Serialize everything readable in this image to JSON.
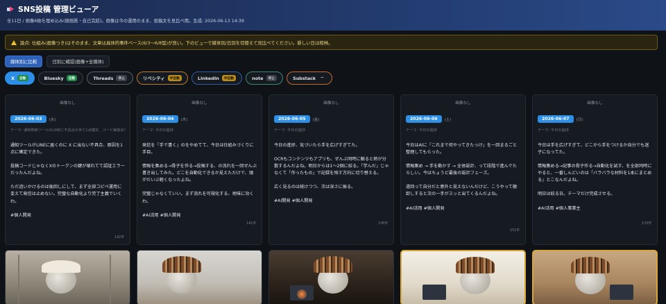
{
  "header": {
    "title": "SNS投稿 管理ビューア",
    "subtitle": "全11日 / 画像6枚を埋め込み(原画質・自己完結)。画像は今の運用のまま、投稿文を見比べ用。生成: 2026-06-13 14:39"
  },
  "notice": {
    "text": "論点: 仕組み(画像つき)はそのまま、文章は具体的事件ベース(6/3〜6/8型)が良い。下のビューで媒体別/日別を切替えて見比べてください。新しい日は榜林。"
  },
  "view_tabs": [
    {
      "label": "媒体別に比較",
      "active": true
    },
    {
      "label": "日別に確認(画像+全媒体)",
      "active": false
    }
  ],
  "platforms": [
    {
      "name": "X",
      "badge": "自動",
      "badge_style": "green",
      "cls": "active"
    },
    {
      "name": "Bluesky",
      "badge": "自動",
      "badge_style": "green",
      "cls": ""
    },
    {
      "name": "Threads",
      "badge": "停止",
      "badge_style": "gray",
      "cls": "threads"
    },
    {
      "name": "リベシティ",
      "badge": "半自動",
      "badge_style": "amber",
      "cls": "rev"
    },
    {
      "name": "LinkedIn",
      "badge": "半自動",
      "badge_style": "amber",
      "cls": "linkedin"
    },
    {
      "name": "note",
      "badge": "停止",
      "badge_style": "gray",
      "cls": "note"
    },
    {
      "name": "Substack",
      "badge": "—",
      "badge_style": "none",
      "cls": "substack"
    }
  ],
  "cards": [
    {
      "no_image": "画像なし",
      "date": "2026-06-03",
      "dow": "(水)",
      "theme": "テーマ: 通知検索ツールのLINEに不具合があり1点確定、コード実装出てた前が受けてた",
      "paragraphs": [
        "通知ツールがLINEに届くのに X に出ない不具合、原因を1点に確定できた。",
        "投稿コードじゃなくXのトークンの鍵が壊れてて認証エラーだったんだよね。",
        "ただ追いかけるのは後回しにして、まず全部コピペ運用に変えて発信は止めない。完璧な自動化より完了主義でいくわ。",
        "#個人開発"
      ],
      "count": "142字",
      "count_top": 339
    },
    {
      "no_image": "画像なし",
      "date": "2026-06-04",
      "dow": "(木)",
      "theme": "テーマ: 今日の進捗",
      "paragraphs": [
        "発信を「手で書く」のをやめてて、今日は仕組みづくりに手目。",
        "情報を集める→骨子を作る→投稿する、の流れを一回ぜんぶ書き出してみた。どこを自動化できるか見えただけで、頭がだいぶ軽くなったよね。",
        "完璧じゃなくていい。まず流れを可視化する、地味に効くわ。",
        "#AI活用 #個人開発"
      ],
      "count": "141字",
      "count_top": 319
    },
    {
      "no_image": "画像なし",
      "date": "2026-06-05",
      "dow": "(金)",
      "theme": "テーマ: 今日の進捗",
      "paragraphs": [
        "今日の進捗、気づいたら手を広げすぎてた。",
        "OCRもコンテンツもアプリも、ぜんぶ同時に触ると熱が分散するんだよね。明日からは1〜2個に絞る。「学んだ」じゃなくて「作ったもの」で記録を残す方向に切り替える。",
        "広く見るのは続けつつ、次は深さに振る。",
        "#AI開発 #個人開発"
      ],
      "count": "136字",
      "count_top": 319
    },
    {
      "no_image": "画像なし",
      "date": "2026-06-06",
      "dow": "(土)",
      "theme": "テーマ: 今日の進捗",
      "paragraphs": [
        "今日はAIに「これまで何やってきたっけ」を一回まるごと整理してもらった。",
        "情報集め → 手を動かす → 全体設計、って段階で進んでたらしい。今はちょうど最後の設計フェーズ。",
        "遠回って自分だと意外と見えないんだけど、こうやって棚卸しすると次の一手がスッと出てくるんだよね。",
        "#AI活用 #個人開発"
      ],
      "count": "151字",
      "count_top": 329
    },
    {
      "no_image": "画像なし",
      "date": "2026-06-07",
      "dow": "(日)",
      "theme": "テーマ: 今日の進捗",
      "paragraphs": [
        "今日は手を広げすぎて、どこから手をつけるか自分でも迷子になってた。",
        "情報集める→記事の骨子作る→自動化を試す、を全部同時にやると、一番しんどいのは「バラバラな材料を1本にまとめる」とこなんだよね。",
        "明日は絞る日。テーマだけ完成させる。",
        "#AI活用 #個人事業主"
      ],
      "count": "133字",
      "count_top": 319
    }
  ]
}
